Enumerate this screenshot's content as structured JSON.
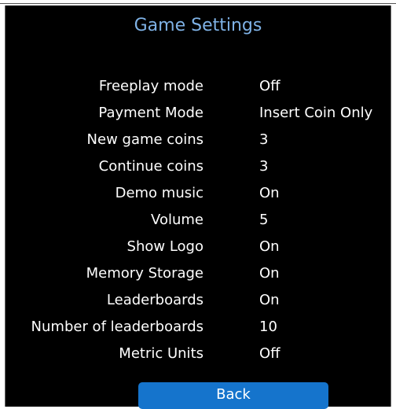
{
  "screen": {
    "title": "Game Settings",
    "background": "#000000",
    "title_color": "#7fb2e6",
    "settings": [
      {
        "label": "Freeplay mode",
        "value": "Off"
      },
      {
        "label": "Payment Mode",
        "value": "Insert Coin Only"
      },
      {
        "label": "New game coins",
        "value": "3"
      },
      {
        "label": "Continue coins",
        "value": "3"
      },
      {
        "label": "Demo music",
        "value": "On"
      },
      {
        "label": "Volume",
        "value": "5"
      },
      {
        "label": "Show Logo",
        "value": "On"
      },
      {
        "label": "Memory Storage",
        "value": "On"
      },
      {
        "label": "Leaderboards",
        "value": "On"
      },
      {
        "label": "Number of leaderboards",
        "value": "10"
      },
      {
        "label": "Metric Units",
        "value": "Off"
      }
    ],
    "back_label": "Back",
    "back_color": "#1574cc"
  }
}
